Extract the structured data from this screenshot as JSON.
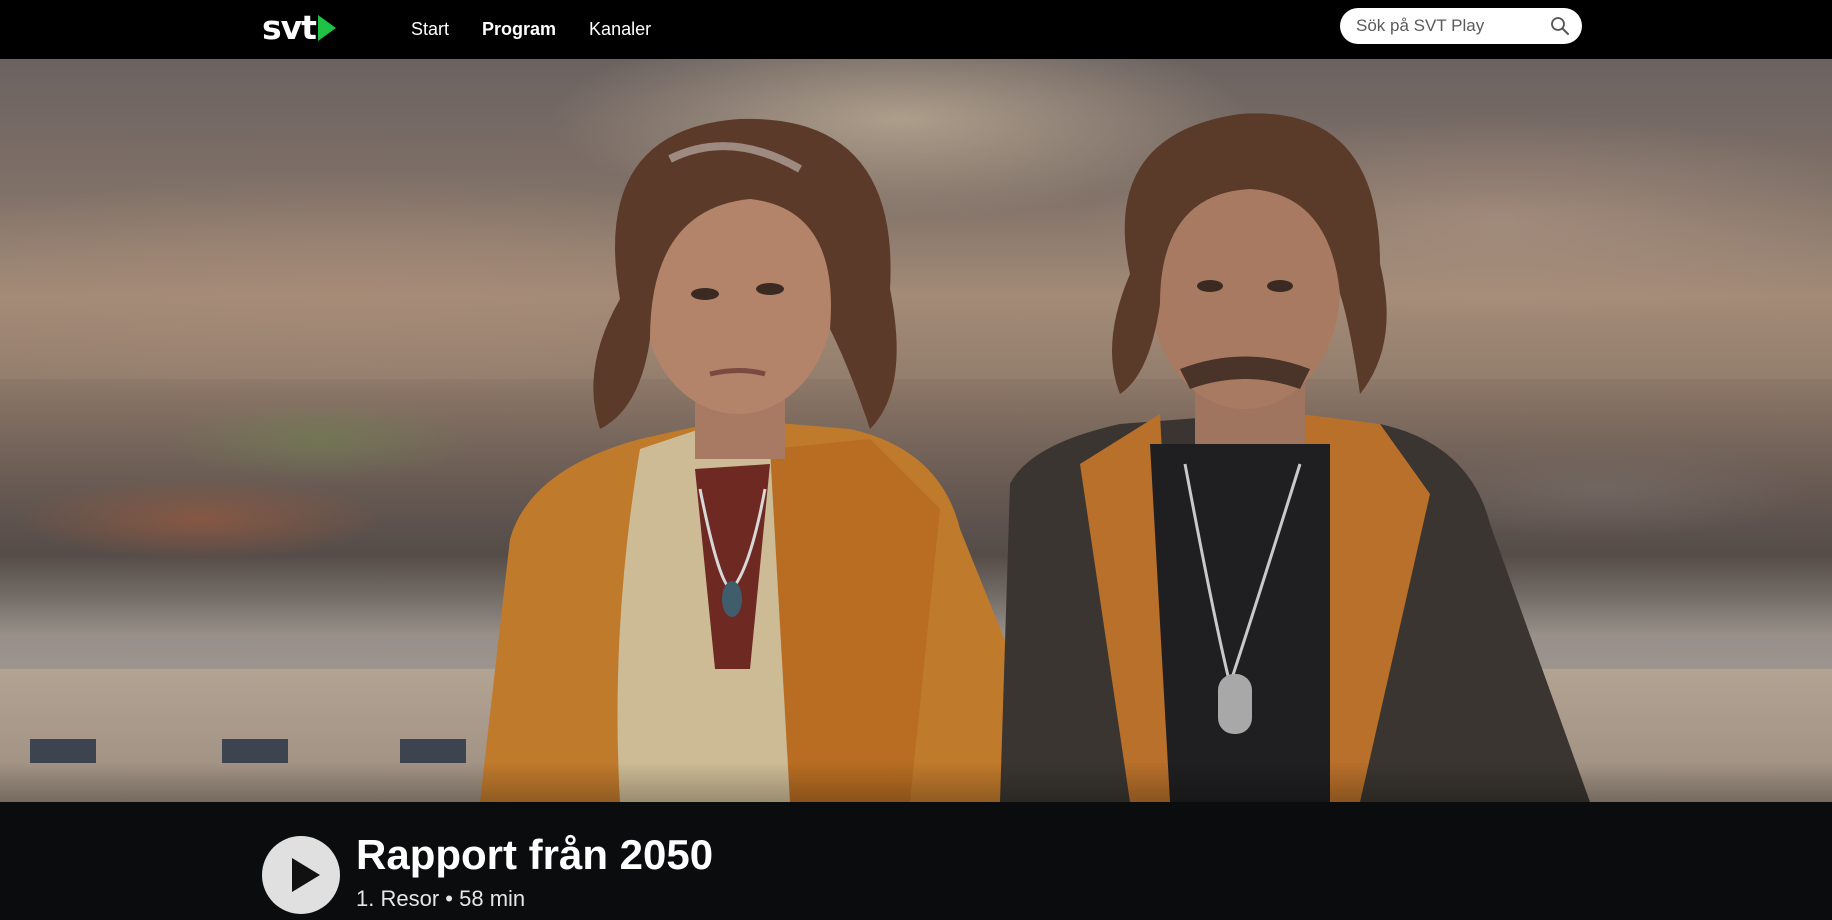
{
  "brand": {
    "logo_text": "svt",
    "accent_color": "#1fc244"
  },
  "nav": {
    "items": [
      {
        "label": "Start",
        "active": false
      },
      {
        "label": "Program",
        "active": true
      },
      {
        "label": "Kanaler",
        "active": false
      }
    ]
  },
  "search": {
    "placeholder": "Sök på SVT Play",
    "icon": "search-icon"
  },
  "hero": {
    "image": "program-hero-image"
  },
  "program": {
    "title": "Rapport från 2050",
    "episode": "1. Resor",
    "separator": "•",
    "duration": "58 min",
    "play_icon": "play-icon"
  }
}
